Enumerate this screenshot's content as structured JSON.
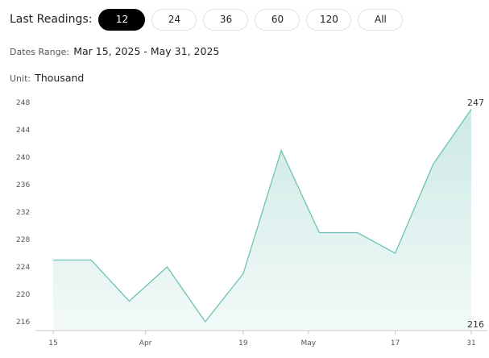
{
  "header": {
    "label": "Last Readings:",
    "buttons": [
      {
        "label": "12",
        "selected": true
      },
      {
        "label": "24",
        "selected": false
      },
      {
        "label": "36",
        "selected": false
      },
      {
        "label": "60",
        "selected": false
      },
      {
        "label": "120",
        "selected": false
      },
      {
        "label": "All",
        "selected": false
      }
    ]
  },
  "dates_range": {
    "label": "Dates Range:",
    "value": "Mar 15, 2025 - May 31, 2025"
  },
  "unit": {
    "label": "Unit:",
    "value": "Thousand"
  },
  "colors": {
    "line": "#6cc3b5",
    "area_top": "#cde9e4",
    "area_bottom": "#f3faf9",
    "selected_button": "#000000"
  },
  "chart_data": {
    "type": "area",
    "title": "",
    "xlabel": "",
    "ylabel": "",
    "x": [
      "2025-03-15",
      "2025-03-22",
      "2025-03-29",
      "2025-04-05",
      "2025-04-12",
      "2025-04-19",
      "2025-04-26",
      "2025-05-03",
      "2025-05-10",
      "2025-05-17",
      "2025-05-24",
      "2025-05-31"
    ],
    "values": [
      225,
      225,
      219,
      224,
      216,
      223,
      241,
      229,
      229,
      226,
      239,
      247
    ],
    "x_ticks": [
      {
        "date": "2025-03-15",
        "label": "15"
      },
      {
        "date": "2025-04-01",
        "label": "Apr"
      },
      {
        "date": "2025-04-19",
        "label": "19"
      },
      {
        "date": "2025-05-01",
        "label": "May"
      },
      {
        "date": "2025-05-17",
        "label": "17"
      },
      {
        "date": "2025-05-31",
        "label": "31"
      }
    ],
    "y_ticks": [
      216,
      220,
      224,
      228,
      232,
      236,
      240,
      244,
      248
    ],
    "ylim": [
      214,
      250
    ],
    "end_labels": {
      "max": "247",
      "min": "216"
    },
    "grid": false
  }
}
